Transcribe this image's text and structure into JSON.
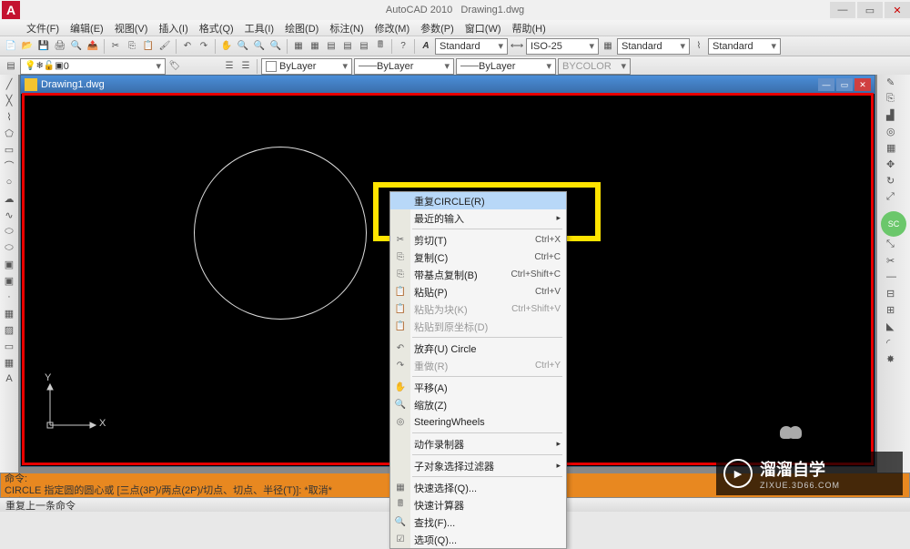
{
  "titlebar": {
    "app_name": "AutoCAD 2010",
    "doc_name": "Drawing1.dwg"
  },
  "menubar": [
    "文件(F)",
    "编辑(E)",
    "视图(V)",
    "插入(I)",
    "格式(Q)",
    "工具(I)",
    "绘图(D)",
    "标注(N)",
    "修改(M)",
    "参数(P)",
    "窗口(W)",
    "帮助(H)"
  ],
  "properties": {
    "layer": "0",
    "color_combo_label": "ByLayer",
    "linetype_label": "ByLayer",
    "lineweight_label": "ByLayer",
    "plot_label": "BYCOLOR",
    "text_style": "Standard",
    "dim_style": "ISO-25",
    "table_style": "Standard",
    "ml_style": "Standard"
  },
  "draw_window": {
    "title": "Drawing1.dwg"
  },
  "ucs": {
    "x": "X",
    "y": "Y"
  },
  "context_menu": [
    {
      "label": "重复CIRCLE(R)",
      "highlighted": true,
      "icon": ""
    },
    {
      "label": "最近的输入",
      "submenu": true,
      "icon": ""
    },
    {
      "sep": true
    },
    {
      "label": "剪切(T)",
      "shortcut": "Ctrl+X",
      "icon": "✂"
    },
    {
      "label": "复制(C)",
      "shortcut": "Ctrl+C",
      "icon": "⎘"
    },
    {
      "label": "带基点复制(B)",
      "shortcut": "Ctrl+Shift+C",
      "icon": "⎘"
    },
    {
      "label": "粘贴(P)",
      "shortcut": "Ctrl+V",
      "icon": "📋"
    },
    {
      "label": "粘贴为块(K)",
      "shortcut": "Ctrl+Shift+V",
      "icon": "📋",
      "disabled": true
    },
    {
      "label": "粘贴到原坐标(D)",
      "icon": "📋",
      "disabled": true
    },
    {
      "sep": true
    },
    {
      "label": "放弃(U) Circle",
      "icon": "↶"
    },
    {
      "label": "重做(R)",
      "shortcut": "Ctrl+Y",
      "icon": "↷",
      "disabled": true
    },
    {
      "sep": true
    },
    {
      "label": "平移(A)",
      "icon": "✋"
    },
    {
      "label": "缩放(Z)",
      "icon": "🔍"
    },
    {
      "label": "SteeringWheels",
      "icon": "◎"
    },
    {
      "sep": true
    },
    {
      "label": "动作录制器",
      "submenu": true
    },
    {
      "sep": true
    },
    {
      "label": "子对象选择过滤器",
      "submenu": true
    },
    {
      "sep": true
    },
    {
      "label": "快速选择(Q)...",
      "icon": "▦",
      "hidden_partial": true
    },
    {
      "label": "快速计算器",
      "icon": "🖩"
    },
    {
      "label": "查找(F)...",
      "icon": "🔍"
    },
    {
      "label": "选项(Q)...",
      "icon": "☑"
    }
  ],
  "command": {
    "line1": "命令:",
    "line2": "CIRCLE 指定圆的圆心或 [三点(3P)/两点(2P)/切点、切点、半径(T)]: *取消*",
    "line3": "命令:"
  },
  "statusbar": {
    "text": "重复上一条命令"
  },
  "watermark": {
    "main": "溜溜自学",
    "sub": "ZIXUE.3D66.COM"
  }
}
